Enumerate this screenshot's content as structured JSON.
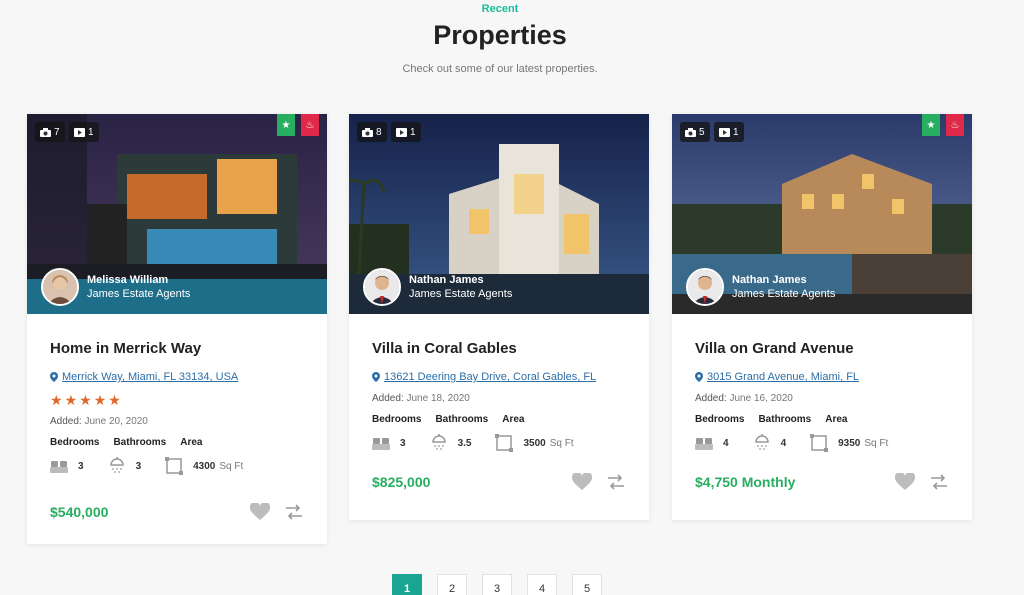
{
  "header": {
    "kicker": "Recent",
    "title": "Properties",
    "subtitle": "Check out some of our latest properties."
  },
  "cards": [
    {
      "photo_count": "7",
      "video_count": "1",
      "featured": true,
      "hot": true,
      "agent_name": "Melissa William",
      "agent_company": "James Estate Agents",
      "title": "Home in Merrick Way",
      "address": "Merrick Way, Miami, FL 33134, USA",
      "rating": 5,
      "added_label": "Added:",
      "added_date": "June 20, 2020",
      "labels": {
        "bedrooms": "Bedrooms",
        "bathrooms": "Bathrooms",
        "area": "Area"
      },
      "bedrooms": "3",
      "bathrooms": "3",
      "area": "4300",
      "area_unit": "Sq Ft",
      "price": "$540,000"
    },
    {
      "photo_count": "8",
      "video_count": "1",
      "featured": false,
      "hot": false,
      "agent_name": "Nathan James",
      "agent_company": "James Estate Agents",
      "title": "Villa in Coral Gables",
      "address": "13621 Deering Bay Drive, Coral Gables, FL",
      "rating": 0,
      "added_label": "Added:",
      "added_date": "June 18, 2020",
      "labels": {
        "bedrooms": "Bedrooms",
        "bathrooms": "Bathrooms",
        "area": "Area"
      },
      "bedrooms": "3",
      "bathrooms": "3.5",
      "area": "3500",
      "area_unit": "Sq Ft",
      "price": "$825,000"
    },
    {
      "photo_count": "5",
      "video_count": "1",
      "featured": true,
      "hot": true,
      "agent_name": "Nathan James",
      "agent_company": "James Estate Agents",
      "title": "Villa on Grand Avenue",
      "address": "3015 Grand Avenue, Miami, FL",
      "rating": 0,
      "added_label": "Added:",
      "added_date": "June 16, 2020",
      "labels": {
        "bedrooms": "Bedrooms",
        "bathrooms": "Bathrooms",
        "area": "Area"
      },
      "bedrooms": "4",
      "bathrooms": "4",
      "area": "9350",
      "area_unit": "Sq Ft",
      "price": "$4,750 Monthly"
    }
  ],
  "pagination": {
    "pages": [
      "1",
      "2",
      "3",
      "4",
      "5"
    ],
    "active": "1"
  },
  "colors": {
    "accent": "#1abc9c",
    "price": "#27ae60",
    "link": "#2c6ea8",
    "star": "#e0672a",
    "tag_featured": "#27ae60",
    "tag_hot": "#e0284a"
  }
}
